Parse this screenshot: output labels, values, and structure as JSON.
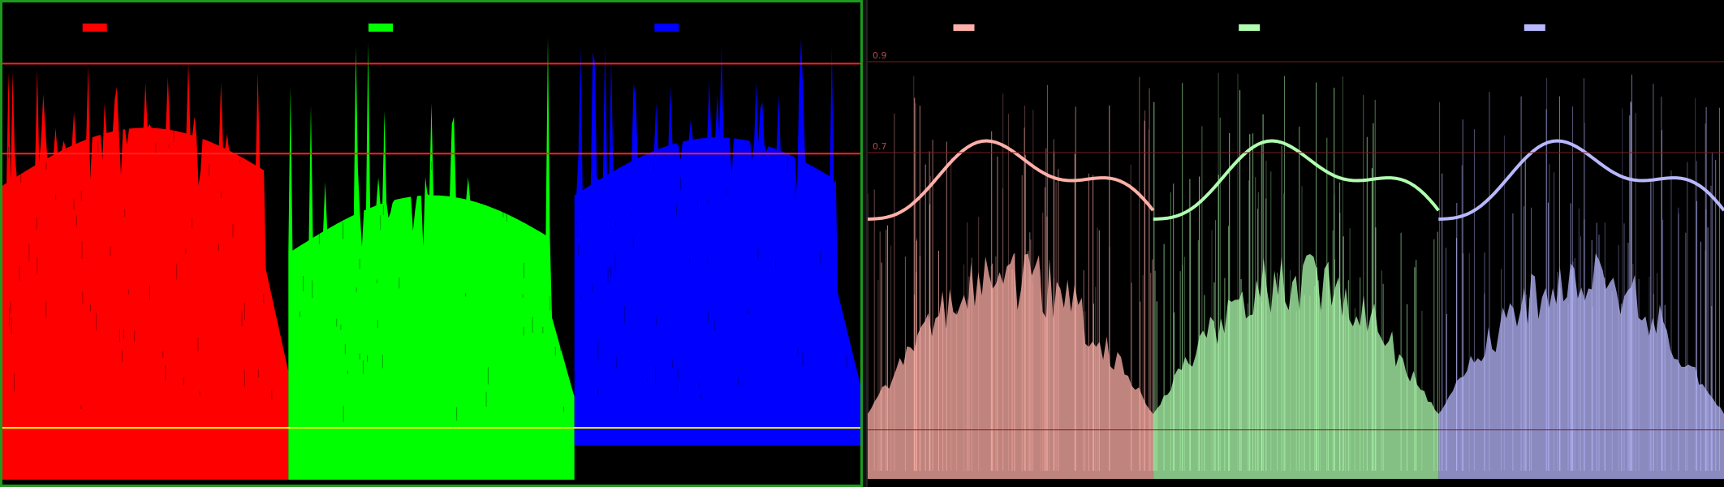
{
  "left_scope": {
    "mode": "rgb-parade-filled",
    "channels": [
      {
        "id": "red",
        "color": "#ff0000"
      },
      {
        "id": "green",
        "color": "#00ff00"
      },
      {
        "id": "blue",
        "color": "#0000ff"
      }
    ],
    "guide_lines": [
      {
        "level": 0.9,
        "color": "#ff2020"
      },
      {
        "level": 0.7,
        "color": "#ff2020"
      },
      {
        "level": 0.09,
        "color": "#ffff00"
      }
    ]
  },
  "right_scope": {
    "mode": "rgb-parade-waveform",
    "channels": [
      {
        "id": "red",
        "color": "#ffb0a8"
      },
      {
        "id": "green",
        "color": "#b0ffb0"
      },
      {
        "id": "blue",
        "color": "#b8b8ff"
      }
    ],
    "guide_lines": [
      {
        "level": 0.9,
        "label": "0.9",
        "color": "#7a1e1e"
      },
      {
        "level": 0.7,
        "label": "0.7",
        "color": "#7a1e1e"
      },
      {
        "level": 0.09,
        "label": "",
        "color": "#7a1e1e"
      }
    ]
  }
}
